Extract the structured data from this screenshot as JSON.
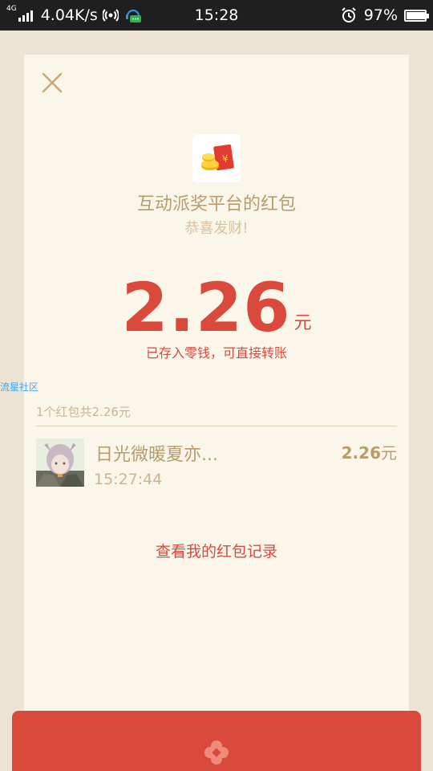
{
  "status_bar": {
    "network": "4G",
    "speed": "4.04K/s",
    "time": "15:28",
    "battery": "97%",
    "battery_level": 0.97
  },
  "card": {
    "sender": "互动派奖平台的红包",
    "wish": "恭喜发财!",
    "amount": "2.26",
    "amount_unit": "元",
    "stored_note": "已存入零钱，可直接转账",
    "summary": "1个红包共2.26元",
    "receiver": {
      "name": "日光微暖夏亦...",
      "time": "15:27:44",
      "amount": "2.26",
      "amount_unit": "元"
    },
    "record_link": "查看我的红包记录"
  },
  "watermark": "流星社区",
  "colors": {
    "background": "#ece4d2",
    "card": "#fbf6ea",
    "accent_red": "#d94a3d",
    "gold_text": "#b99b6b",
    "light_gold": "#cbb58f"
  }
}
